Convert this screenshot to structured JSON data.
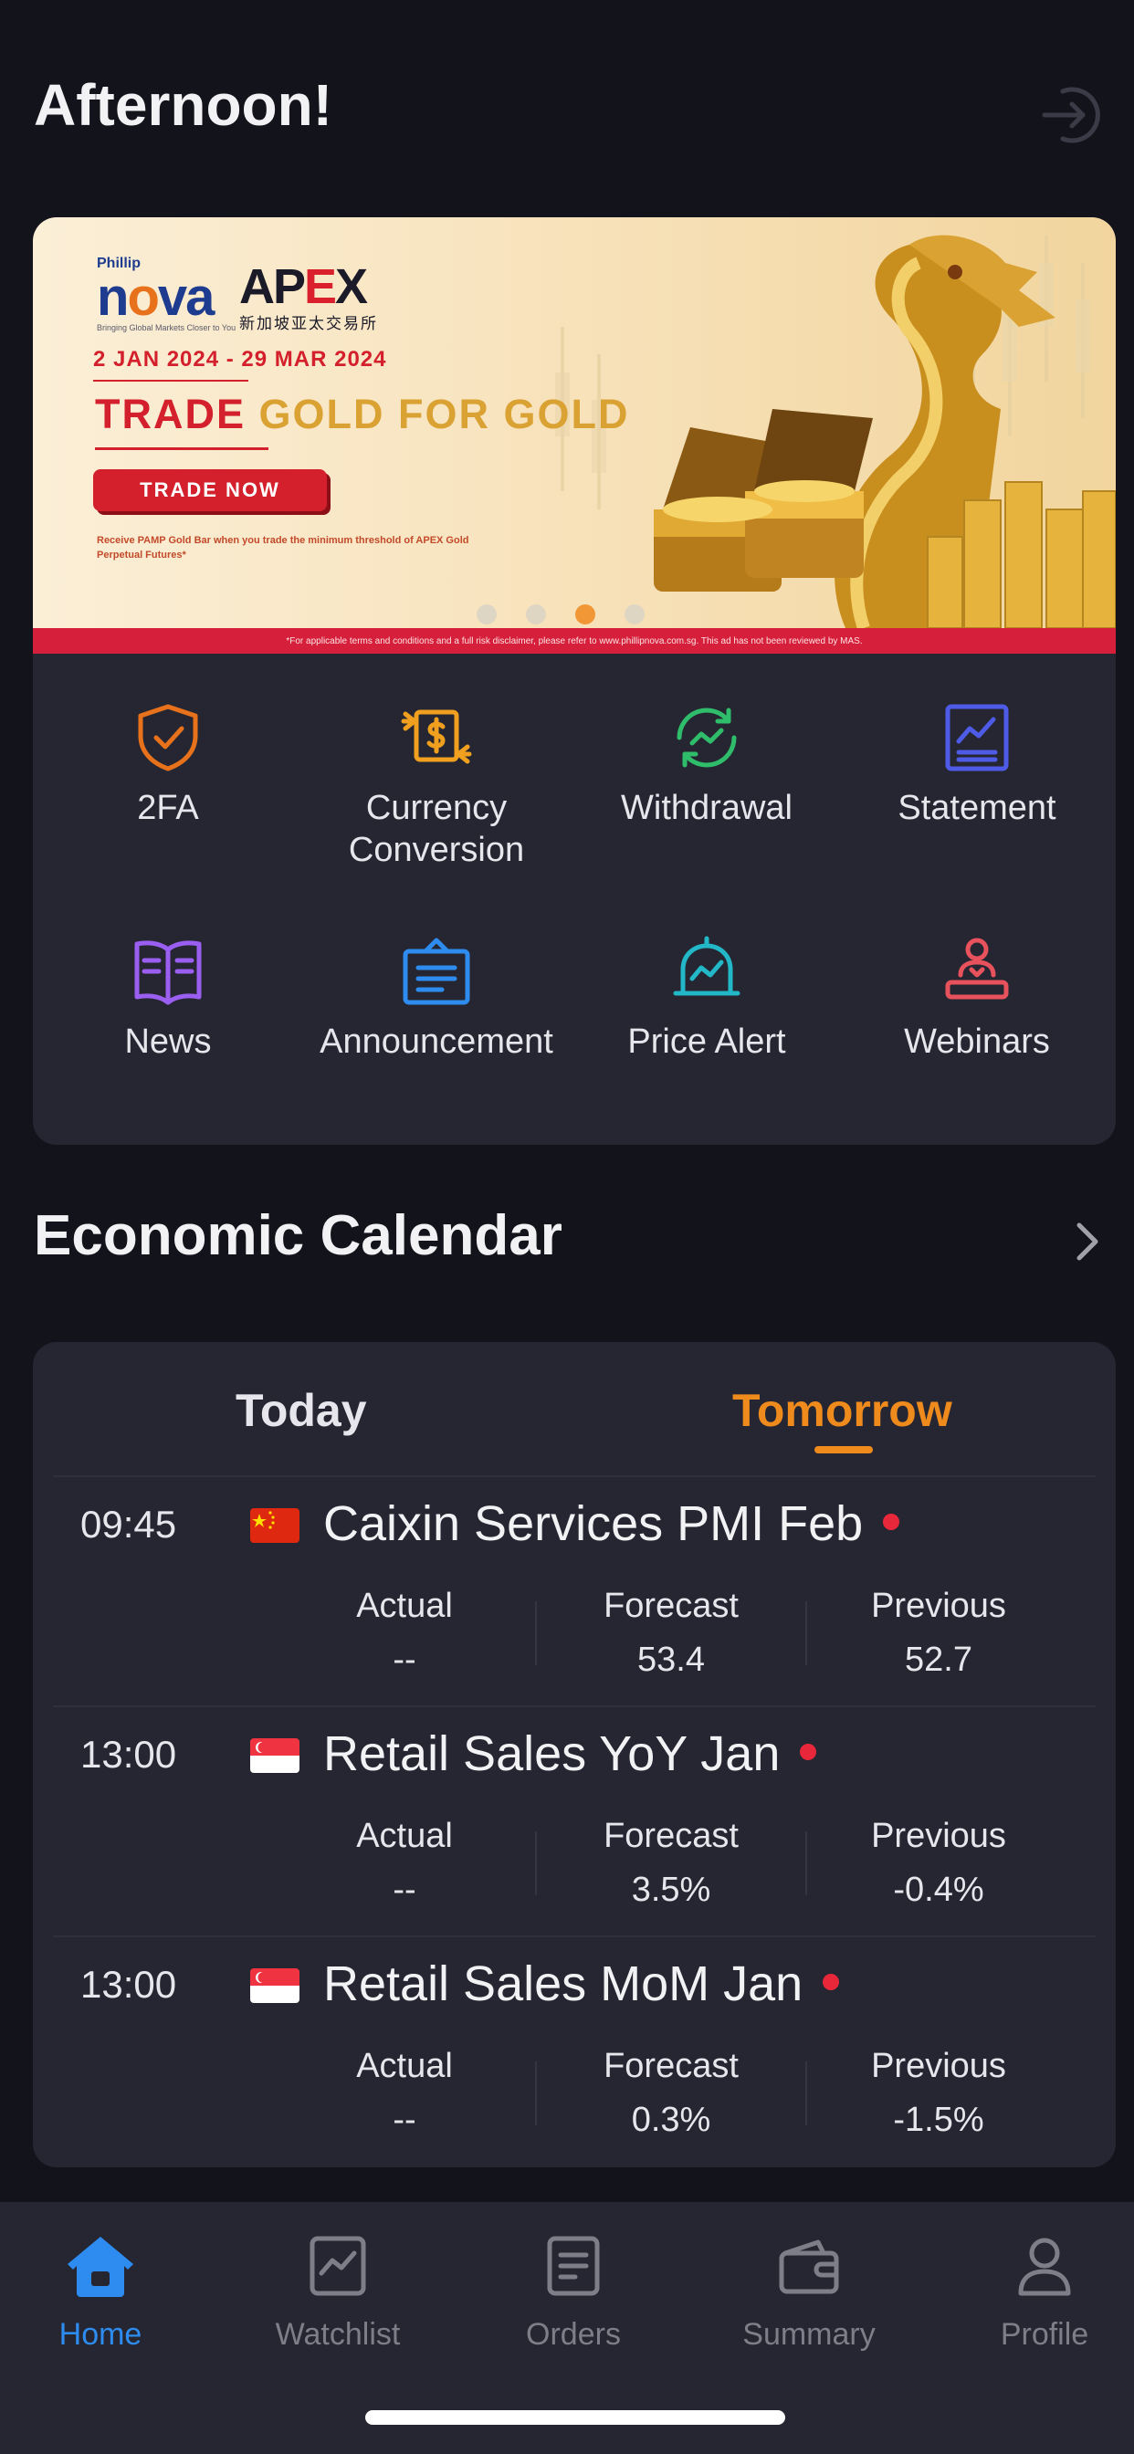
{
  "header": {
    "greeting": "Afternoon!"
  },
  "banner": {
    "brand_small": "Phillip",
    "brand_big_a": "n",
    "brand_big_b": "o",
    "brand_big_c": "va",
    "brand_tagline": "Bringing Global Markets Closer to You",
    "apex_a": "AP",
    "apex_b": "E",
    "apex_c": "X",
    "apex_sub": "新加坡亚太交易所",
    "date_range": "2 JAN 2024 - 29 MAR 2024",
    "headline_red": "TRADE ",
    "headline_gold": "GOLD FOR GOLD",
    "cta": "TRADE NOW",
    "fine_print": "Receive PAMP Gold Bar when you trade the minimum threshold of APEX Gold Perpetual Futures*",
    "disclaimer": "*For applicable terms and conditions and a full risk disclaimer, please refer to www.phillipnova.com.sg. This ad has not been reviewed by MAS.",
    "slides": 4,
    "active_slide": 3
  },
  "quick_actions": [
    {
      "label": "2FA",
      "icon": "shield-check-icon",
      "color": "#e8721c"
    },
    {
      "label": "Currency\nConversion",
      "icon": "currency-exchange-icon",
      "color": "#f0a01e"
    },
    {
      "label": "Withdrawal",
      "icon": "refresh-chart-icon",
      "color": "#2fbd6b"
    },
    {
      "label": "Statement",
      "icon": "statement-chart-icon",
      "color": "#4d5be6"
    },
    {
      "label": "News",
      "icon": "open-book-icon",
      "color": "#9a5ff0"
    },
    {
      "label": "Announcement",
      "icon": "clipboard-icon",
      "color": "#2e8cf0"
    },
    {
      "label": "Price Alert",
      "icon": "bell-chart-icon",
      "color": "#22b8c8"
    },
    {
      "label": "Webinars",
      "icon": "presenter-icon",
      "color": "#e8525c"
    }
  ],
  "calendar": {
    "title": "Economic Calendar",
    "tabs": {
      "today": "Today",
      "tomorrow": "Tomorrow",
      "active": "tomorrow"
    },
    "events": [
      {
        "time": "09:45",
        "flag": "china-flag-icon",
        "title": "Caixin Services PMI Feb",
        "actual_label": "Actual",
        "actual": "--",
        "forecast_label": "Forecast",
        "forecast": "53.4",
        "previous_label": "Previous",
        "previous": "52.7"
      },
      {
        "time": "13:00",
        "flag": "singapore-flag-icon",
        "title": "Retail Sales YoY Jan",
        "actual_label": "Actual",
        "actual": "--",
        "forecast_label": "Forecast",
        "forecast": "3.5%",
        "previous_label": "Previous",
        "previous": "-0.4%"
      },
      {
        "time": "13:00",
        "flag": "singapore-flag-icon",
        "title": "Retail Sales MoM Jan",
        "actual_label": "Actual",
        "actual": "--",
        "forecast_label": "Forecast",
        "forecast": "0.3%",
        "previous_label": "Previous",
        "previous": "-1.5%"
      }
    ]
  },
  "tabbar": [
    {
      "label": "Home",
      "icon": "home-icon",
      "active": true
    },
    {
      "label": "Watchlist",
      "icon": "watchlist-icon",
      "active": false
    },
    {
      "label": "Orders",
      "icon": "orders-icon",
      "active": false
    },
    {
      "label": "Summary",
      "icon": "wallet-icon",
      "active": false
    },
    {
      "label": "Profile",
      "icon": "profile-icon",
      "active": false
    }
  ],
  "colors": {
    "background": "#13141b",
    "card": "#252631",
    "accent_orange": "#ef8a1d",
    "accent_blue": "#2e8cf0",
    "alert_red": "#e8283a"
  }
}
